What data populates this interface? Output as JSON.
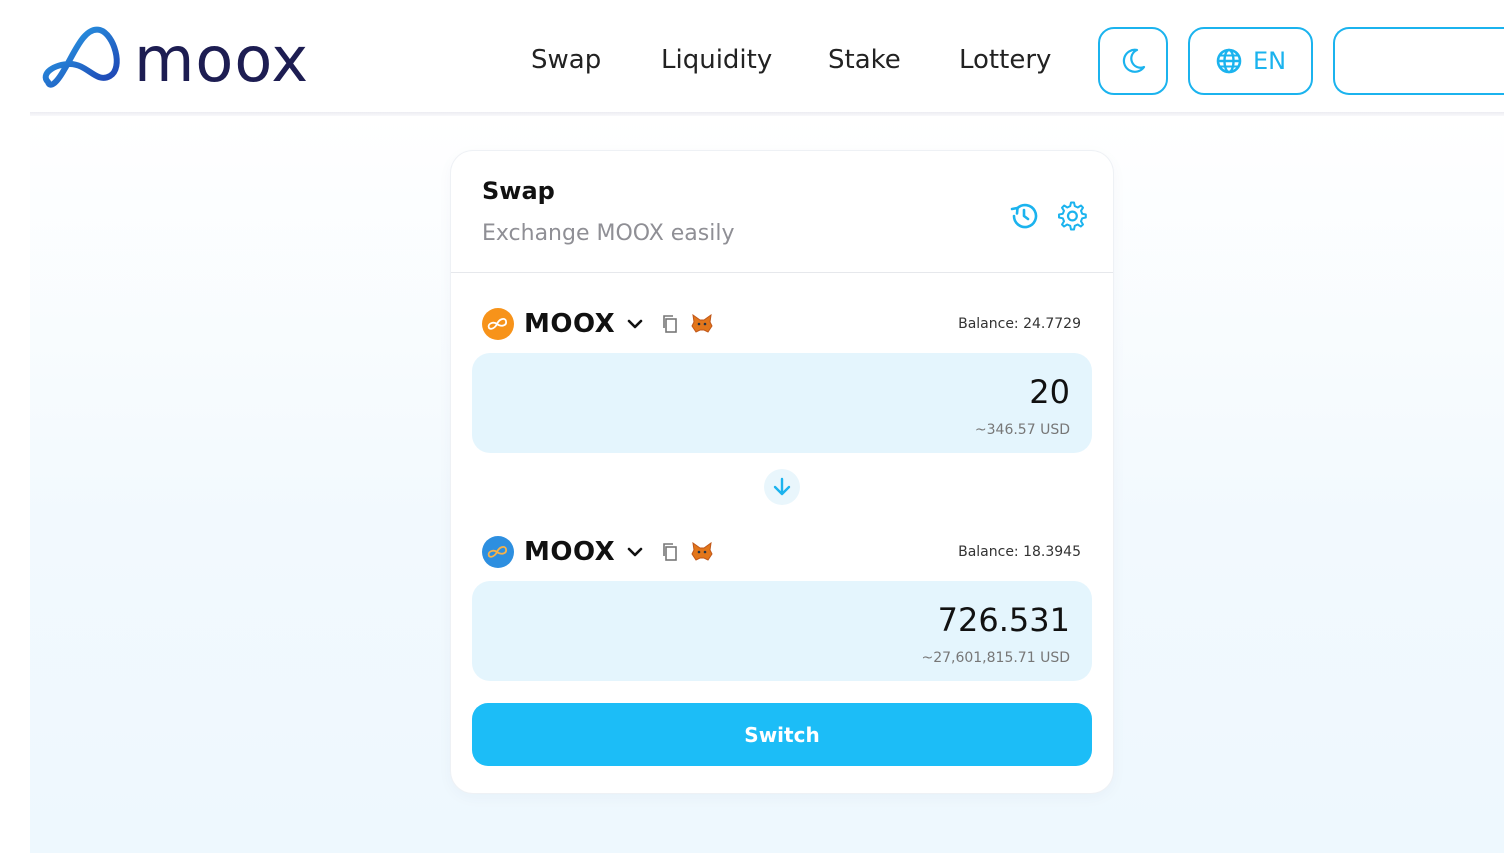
{
  "brand": {
    "name": "moox"
  },
  "nav": [
    {
      "label": "Swap"
    },
    {
      "label": "Liquidity"
    },
    {
      "label": "Stake"
    },
    {
      "label": "Lottery"
    }
  ],
  "header_controls": {
    "theme_icon": "moon-icon",
    "language_icon": "globe-icon",
    "language_label": "EN",
    "connect_label": ""
  },
  "swap_card": {
    "title": "Swap",
    "subtitle": "Exchange MOOX easily",
    "history_icon": "history-icon",
    "settings_icon": "gear-icon",
    "from": {
      "token": "MOOX",
      "balance_text": "Balance: 24.7729",
      "amount": "20",
      "usd_value": "~346.57 USD",
      "logo_color": "#f7931a"
    },
    "to": {
      "token": "MOOX",
      "balance_text": "Balance: 18.3945",
      "amount": "726.531",
      "usd_value": "~27,601,815.71 USD",
      "logo_color": "#2d8fe0"
    },
    "direction_icon": "arrow-down-icon",
    "switch_label": "Switch"
  },
  "colors": {
    "accent": "#1cbdf7",
    "outline": "#1bb3ee",
    "input_bg": "#e4f5fd",
    "brand_text": "#1d1d52"
  }
}
